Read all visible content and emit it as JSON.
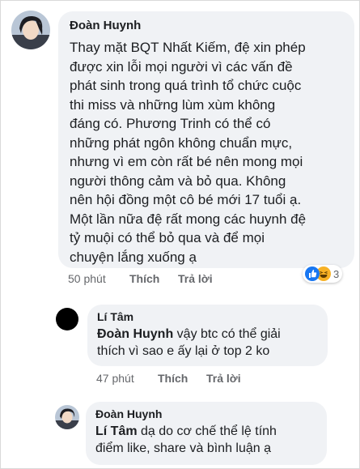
{
  "comments": [
    {
      "author": "Đoàn Huynh",
      "lines": [
        "Thay mặt BQT Nhất Kiếm, đệ xin phép",
        "được xin lỗi mọi người vì các vấn đề",
        "phát sinh trong quá trình tổ chức cuộc",
        "thi miss và những lùm xùm không",
        "đáng có. Phương Trinh có thể có",
        "những phát ngôn không chuẩn mực,",
        "nhưng vì em còn rất bé nên mong mọi",
        "người thông cảm và bỏ qua. Không",
        "nên hội đồng một cô bé mới 17 tuổi ạ.",
        "Một lần nữa đệ rất mong các huynh đệ",
        "tỷ muội có thể bỏ qua và để mọi",
        "chuyện lắng xuống ạ"
      ],
      "time": "50 phút",
      "like_label": "Thích",
      "reply_label": "Trả lời",
      "reaction_count": "3",
      "reaction_icons": [
        "like-icon",
        "haha-icon"
      ]
    },
    {
      "author": "Lí Tâm",
      "tag": "Đoàn Huynh",
      "line1_rest": " vậy btc có thể giải",
      "line2": "thích vì sao e ấy lại ở top 2 ko",
      "time": "47 phút",
      "like_label": "Thích",
      "reply_label": "Trả lời"
    },
    {
      "author": "Đoàn Huynh",
      "tag": "Lí Tâm",
      "line1_rest": " dạ do cơ chế thể lệ tính",
      "line2": "điểm like, share và bình luận ạ"
    }
  ],
  "colors": {
    "bubble": "#f0f2f5",
    "text": "#1c1e21",
    "meta": "#65676b",
    "like_blue": "#1877f2",
    "haha_yellow": "#f7b125"
  }
}
